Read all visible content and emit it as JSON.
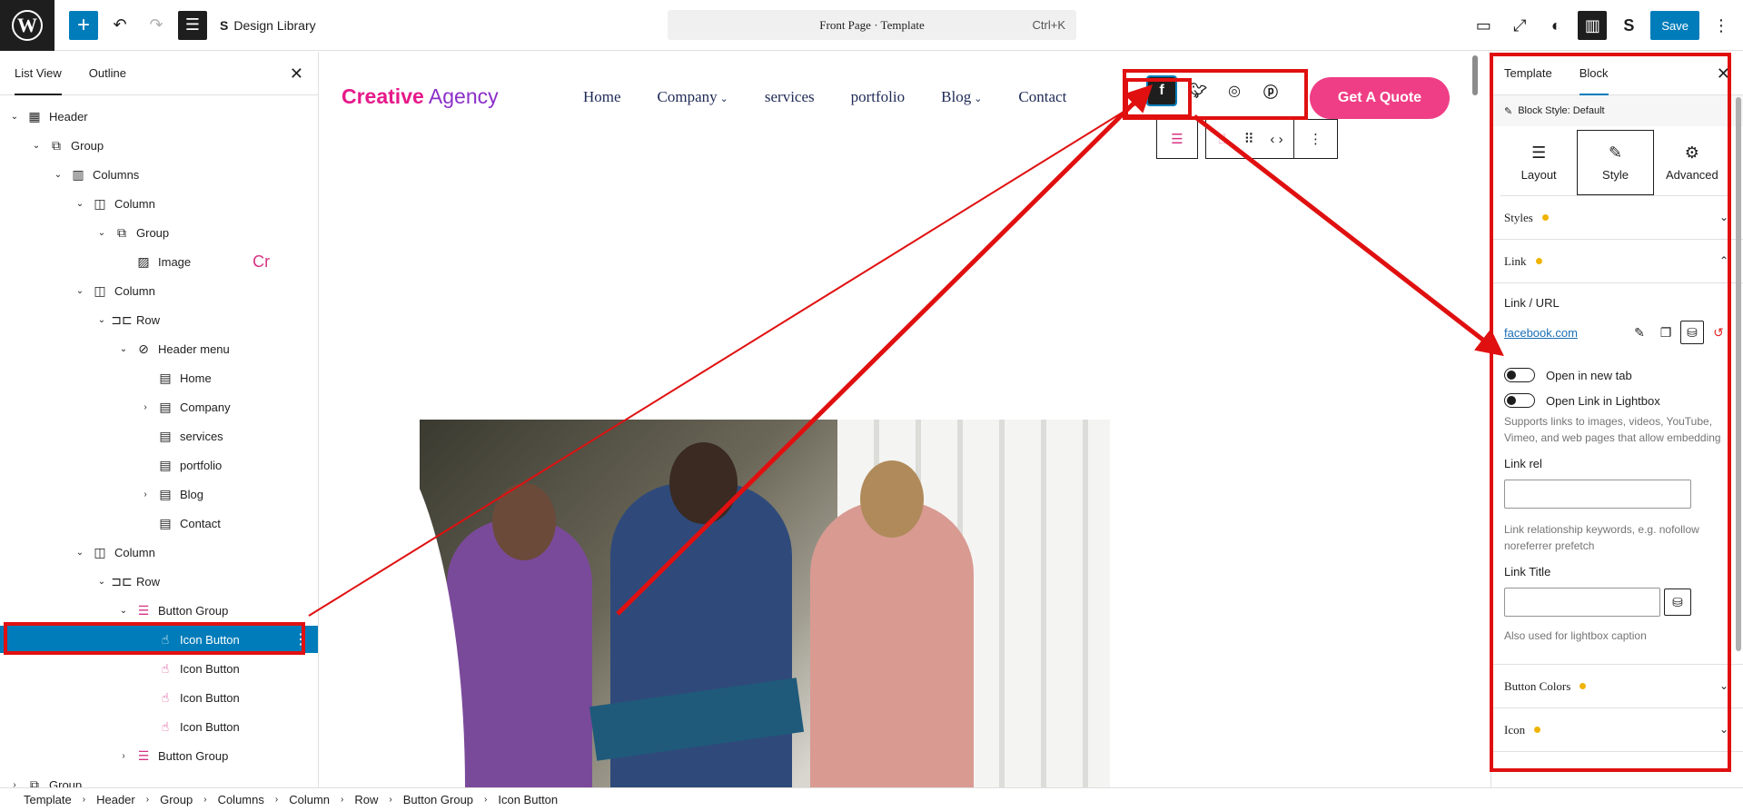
{
  "topbar": {
    "wp_logo": "W",
    "design_library": "Design Library",
    "command_title": "Front Page · Template",
    "command_shortcut": "Ctrl+K",
    "save": "Save"
  },
  "left_panel": {
    "tabs": [
      "List View",
      "Outline"
    ],
    "tree": [
      {
        "label": "Header",
        "depth": 0,
        "chev": "open",
        "icon": "template-icon",
        "glyph": "▦",
        "magenta": false
      },
      {
        "label": "Group",
        "depth": 1,
        "chev": "open",
        "icon": "group-icon",
        "glyph": "⧉",
        "magenta": false
      },
      {
        "label": "Columns",
        "depth": 2,
        "chev": "open",
        "icon": "columns-icon",
        "glyph": "▥",
        "magenta": false
      },
      {
        "label": "Column",
        "depth": 3,
        "chev": "open",
        "icon": "column-icon",
        "glyph": "◫",
        "magenta": false
      },
      {
        "label": "Group",
        "depth": 4,
        "chev": "open",
        "icon": "group-icon",
        "glyph": "⧉",
        "magenta": false
      },
      {
        "label": "Image",
        "depth": 5,
        "chev": "none",
        "icon": "image-icon",
        "glyph": "▨",
        "magenta": false,
        "extra": "Cr"
      },
      {
        "label": "Column",
        "depth": 3,
        "chev": "open",
        "icon": "column-icon",
        "glyph": "◫",
        "magenta": false
      },
      {
        "label": "Row",
        "depth": 4,
        "chev": "open",
        "icon": "row-icon",
        "glyph": "⊐⊏",
        "magenta": false
      },
      {
        "label": "Header menu",
        "depth": 5,
        "chev": "open",
        "icon": "navigation-icon",
        "glyph": "⊘",
        "magenta": false
      },
      {
        "label": "Home",
        "depth": 6,
        "chev": "none",
        "icon": "page-icon",
        "glyph": "▤",
        "magenta": false
      },
      {
        "label": "Company",
        "depth": 6,
        "chev": "closed",
        "icon": "page-icon",
        "glyph": "▤",
        "magenta": false
      },
      {
        "label": "services",
        "depth": 6,
        "chev": "none",
        "icon": "page-icon",
        "glyph": "▤",
        "magenta": false
      },
      {
        "label": "portfolio",
        "depth": 6,
        "chev": "none",
        "icon": "page-icon",
        "glyph": "▤",
        "magenta": false
      },
      {
        "label": "Blog",
        "depth": 6,
        "chev": "closed",
        "icon": "page-icon",
        "glyph": "▤",
        "magenta": false
      },
      {
        "label": "Contact",
        "depth": 6,
        "chev": "none",
        "icon": "page-icon",
        "glyph": "▤",
        "magenta": false
      },
      {
        "label": "Column",
        "depth": 3,
        "chev": "open",
        "icon": "column-icon",
        "glyph": "◫",
        "magenta": false
      },
      {
        "label": "Row",
        "depth": 4,
        "chev": "open",
        "icon": "row-icon",
        "glyph": "⊐⊏",
        "magenta": false
      },
      {
        "label": "Button Group",
        "depth": 5,
        "chev": "open",
        "icon": "button-group-icon",
        "glyph": "☰",
        "magenta": true
      },
      {
        "label": "Icon Button",
        "depth": 6,
        "chev": "none",
        "icon": "hand-pointer-icon",
        "glyph": "☝",
        "magenta": true,
        "selected": true
      },
      {
        "label": "Icon Button",
        "depth": 6,
        "chev": "none",
        "icon": "hand-pointer-icon",
        "glyph": "☝",
        "magenta": true
      },
      {
        "label": "Icon Button",
        "depth": 6,
        "chev": "none",
        "icon": "hand-pointer-icon",
        "glyph": "☝",
        "magenta": true
      },
      {
        "label": "Icon Button",
        "depth": 6,
        "chev": "none",
        "icon": "hand-pointer-icon",
        "glyph": "☝",
        "magenta": true
      },
      {
        "label": "Button Group",
        "depth": 5,
        "chev": "closed",
        "icon": "button-group-icon",
        "glyph": "☰",
        "magenta": true
      },
      {
        "label": "Group",
        "depth": 0,
        "chev": "closed",
        "icon": "group-icon",
        "glyph": "⧉",
        "magenta": false
      }
    ]
  },
  "canvas": {
    "logo_part1": "Creative",
    "logo_part2": " Agency",
    "nav": [
      {
        "label": "Home",
        "dropdown": false
      },
      {
        "label": "Company",
        "dropdown": true
      },
      {
        "label": "services",
        "dropdown": false
      },
      {
        "label": "portfolio",
        "dropdown": false
      },
      {
        "label": "Blog",
        "dropdown": true
      },
      {
        "label": "Contact",
        "dropdown": false
      }
    ],
    "social_icons": [
      "facebook-icon",
      "twitter-icon",
      "instagram-icon",
      "pinterest-icon"
    ],
    "cta": "Get A Quote"
  },
  "right_panel": {
    "tabs": [
      "Template",
      "Block"
    ],
    "block_style": "Block Style: Default",
    "segments": [
      {
        "label": "Layout",
        "icon": "layout-icon",
        "glyph": "☰"
      },
      {
        "label": "Style",
        "icon": "brush-icon",
        "glyph": "✎"
      },
      {
        "label": "Advanced",
        "icon": "gear-icon",
        "glyph": "⚙"
      }
    ],
    "sections": {
      "styles": "Styles",
      "link": "Link",
      "button_colors": "Button Colors",
      "icon": "Icon"
    },
    "link": {
      "url_label": "Link / URL",
      "url": "facebook.com",
      "new_tab": "Open in new tab",
      "lightbox": "Open Link in Lightbox",
      "lightbox_help": "Supports links to images, videos, YouTube, Vimeo, and web pages that allow embedding",
      "rel_label": "Link rel",
      "rel_help": "Link relationship keywords, e.g. nofollow noreferrer prefetch",
      "title_label": "Link Title",
      "title_help": "Also used for lightbox caption"
    }
  },
  "breadcrumbs": [
    "Template",
    "Header",
    "Group",
    "Columns",
    "Column",
    "Row",
    "Button Group",
    "Icon Button"
  ],
  "colors": {
    "accent": "#007cba",
    "brand_pink": "#ef3e85",
    "annotation_red": "#e01010",
    "status_dot": "#f0b400"
  }
}
